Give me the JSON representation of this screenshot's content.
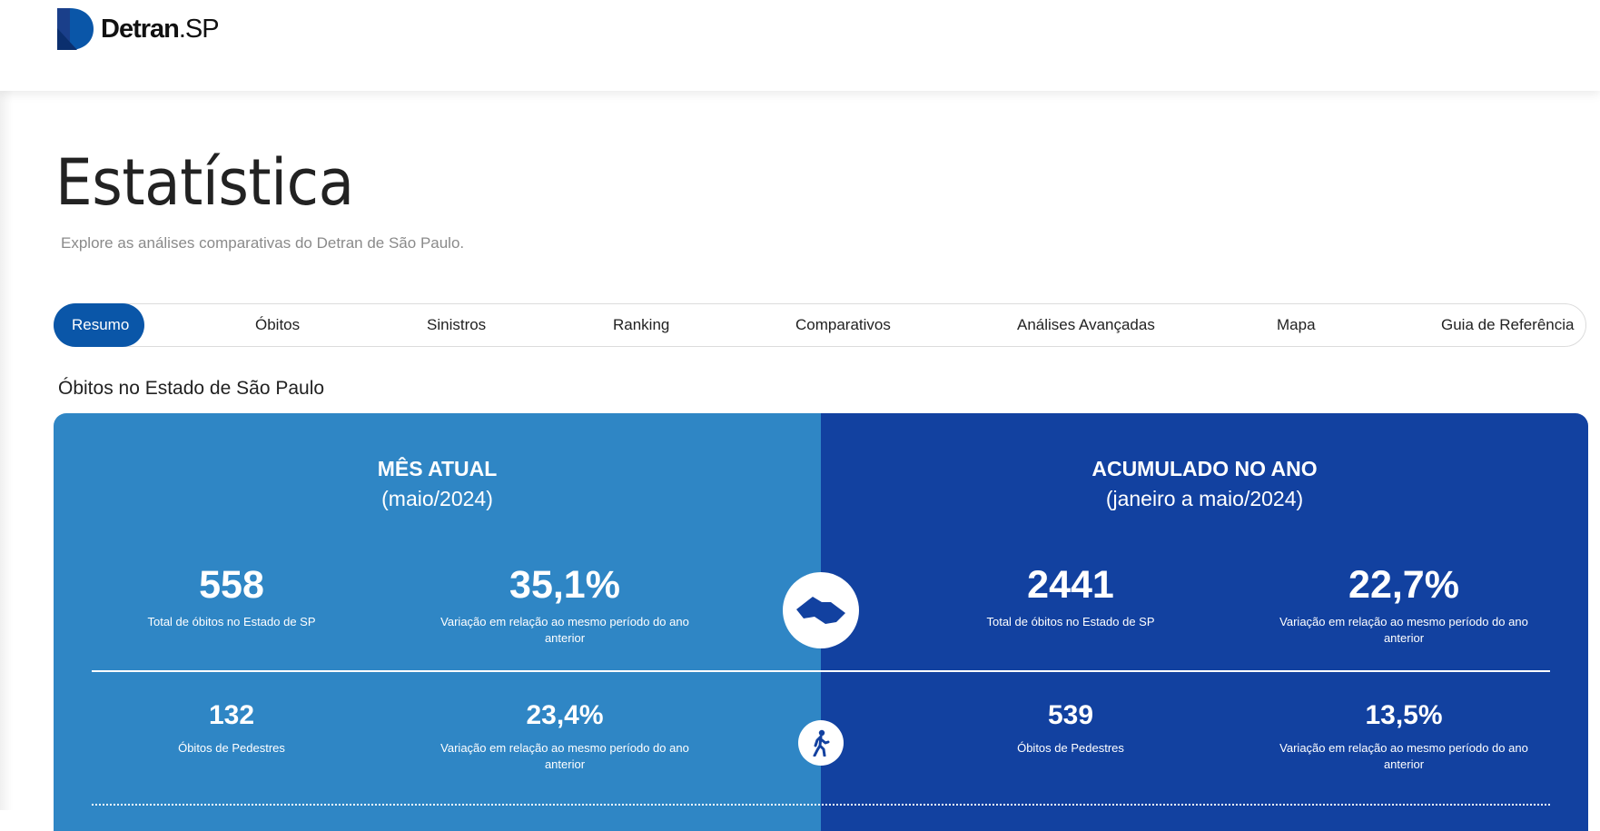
{
  "brand": {
    "name": "Detran",
    "suffix": ".SP",
    "color": "#0a56a8",
    "icon": "detran-logo-icon"
  },
  "page": {
    "title": "Estatística",
    "subtitle": "Explore as análises comparativas do Detran de São Paulo."
  },
  "tabs": [
    {
      "label": "Resumo",
      "active": true
    },
    {
      "label": "Óbitos"
    },
    {
      "label": "Sinistros"
    },
    {
      "label": "Ranking"
    },
    {
      "label": "Comparativos"
    },
    {
      "label": "Análises Avançadas"
    },
    {
      "label": "Mapa"
    },
    {
      "label": "Guia de Referência"
    }
  ],
  "section": {
    "heading": "Óbitos no Estado de São Paulo"
  },
  "colors": {
    "left_panel": "#2f86c5",
    "right_panel": "#1241a0",
    "active_tab": "#0a56a8"
  },
  "left": {
    "title": "MÊS ATUAL",
    "period": "(maio/2024)",
    "total": {
      "value": "558",
      "label": "Total de óbitos no Estado de SP"
    },
    "total_var": {
      "value": "35,1%",
      "label": "Variação em relação ao mesmo período do ano anterior"
    },
    "ped": {
      "value": "132",
      "label": "Óbitos de Pedestres"
    },
    "ped_var": {
      "value": "23,4%",
      "label": "Variação em relação ao mesmo período do ano anterior"
    }
  },
  "right": {
    "title": "ACUMULADO NO ANO",
    "period": "(janeiro a maio/2024)",
    "total": {
      "value": "2441",
      "label": "Total de óbitos no Estado de SP"
    },
    "total_var": {
      "value": "22,7%",
      "label": "Variação em relação ao mesmo período do ano anterior"
    },
    "ped": {
      "value": "539",
      "label": "Óbitos de Pedestres"
    },
    "ped_var": {
      "value": "13,5%",
      "label": "Variação em relação ao mesmo período do ano anterior"
    }
  },
  "icons": {
    "state": "sao-paulo-state-map-icon",
    "pedestrian": "pedestrian-icon"
  }
}
